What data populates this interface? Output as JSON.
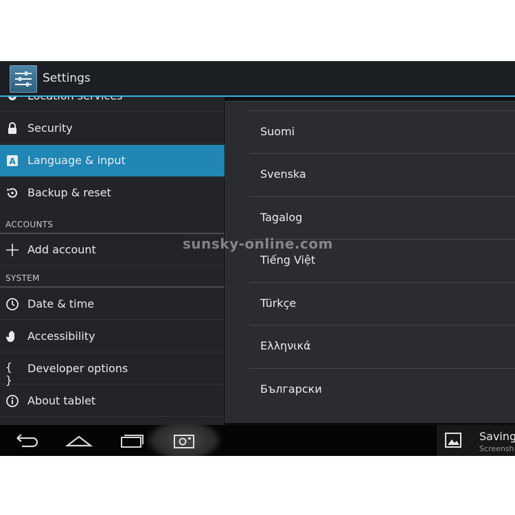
{
  "action_bar": {
    "title": "Settings",
    "icon": "settings-sliders-icon"
  },
  "settings": {
    "partial_item": {
      "label": "Location services",
      "icon": "location-icon"
    },
    "items": [
      {
        "label": "Security",
        "icon": "lock-icon"
      },
      {
        "label": "Language & input",
        "icon": "language-icon",
        "selected": true
      },
      {
        "label": "Backup & reset",
        "icon": "backup-restore-icon"
      }
    ],
    "accounts_header": "ACCOUNTS",
    "accounts_items": [
      {
        "label": "Add account",
        "icon": "plus-icon"
      }
    ],
    "system_header": "SYSTEM",
    "system_items": [
      {
        "label": "Date & time",
        "icon": "clock-icon"
      },
      {
        "label": "Accessibility",
        "icon": "hand-icon"
      },
      {
        "label": "Developer options",
        "icon": "braces-icon"
      },
      {
        "label": "About tablet",
        "icon": "info-icon"
      }
    ]
  },
  "languages": [
    "Suomi",
    "Svenska",
    "Tagalog",
    "Tiếng Việt",
    "Türkçe",
    "Ελληνικά",
    "Български"
  ],
  "watermark": "sunsky-online.com",
  "nav_bar": {
    "buttons": [
      "back-icon",
      "home-icon",
      "recent-apps-icon",
      "screenshot-icon"
    ]
  },
  "notification": {
    "title": "Saving",
    "subtitle": "Screensh",
    "icon": "image-icon"
  },
  "colors": {
    "accent": "#33b5e5",
    "selected": "#1f86b6"
  }
}
